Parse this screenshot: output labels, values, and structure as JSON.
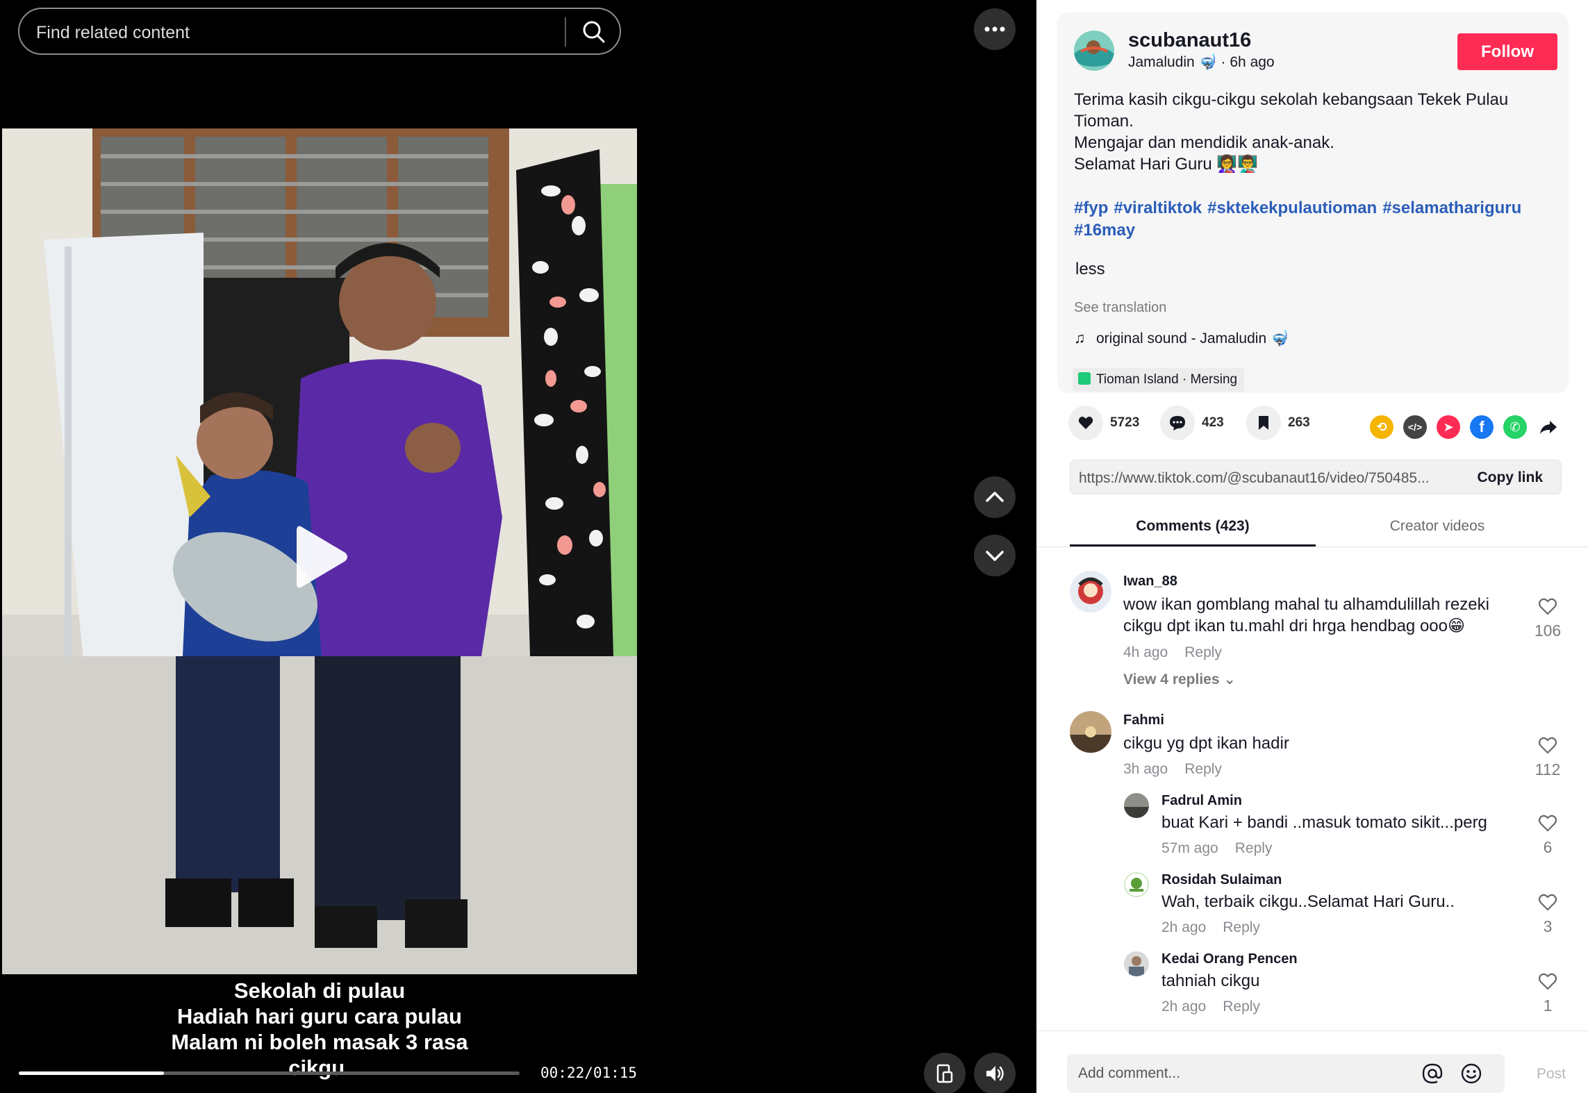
{
  "search": {
    "placeholder": "Find related content"
  },
  "video": {
    "caption_lines": [
      "Sekolah di pulau",
      "Hadiah hari guru cara pulau",
      "Malam ni boleh masak 3 rasa",
      "cikgu."
    ],
    "progress": 0.29,
    "time": "00:22/01:15"
  },
  "post": {
    "author": "scubanaut16",
    "author_name": "Jamaludin 🤿",
    "age": "6h ago",
    "follow_label": "Follow",
    "desc_lines": [
      "Terima kasih cikgu-cikgu sekolah kebangsaan Tekek Pulau",
      "Tioman.",
      "Mengajar dan mendidik anak-anak.",
      "Selamat Hari Guru 👩‍🏫👨‍🏫"
    ],
    "hashtags": [
      "#fyp",
      "#viraltiktok",
      "#sktekekpulautioman",
      "#selamathariguru",
      "#16may"
    ],
    "less_label": "less",
    "see_translation": "See translation",
    "sound": "original sound - Jamaludin 🤿",
    "location": "Tioman Island · Mersing"
  },
  "stats": {
    "likes": "5723",
    "comments": "423",
    "saves": "263"
  },
  "share_icons": [
    {
      "name": "repost-icon",
      "color": "#f5b400"
    },
    {
      "name": "embed-icon",
      "color": "#444444"
    },
    {
      "name": "send-icon",
      "color": "#fe2c55"
    },
    {
      "name": "facebook-icon",
      "color": "#1877f2"
    },
    {
      "name": "whatsapp-icon",
      "color": "#25d366"
    },
    {
      "name": "share-arrow-icon",
      "color": "#161823"
    }
  ],
  "link": {
    "url": "https://www.tiktok.com/@scubanaut16/video/750485...",
    "copy_label": "Copy link"
  },
  "tabs": {
    "comments": "Comments (423)",
    "videos": "Creator videos"
  },
  "comments": [
    {
      "user": "Iwan_88",
      "text": [
        "wow ikan gomblang mahal tu alhamdulillah rezeki",
        "cikgu dpt ikan tu.mahl dri hrga hendbag ooo😁"
      ],
      "age": "4h ago",
      "reply": "Reply",
      "likes": "106",
      "view_replies": "View 4 replies"
    },
    {
      "user": "Fahmi",
      "text": [
        "cikgu yg dpt ikan hadir"
      ],
      "age": "3h ago",
      "reply": "Reply",
      "likes": "112"
    },
    {
      "user": "Fadrul Amin",
      "text": [
        "buat Kari + bandi ..masuk tomato sikit...perg"
      ],
      "age": "57m ago",
      "reply": "Reply",
      "likes": "6"
    },
    {
      "user": "Rosidah Sulaiman",
      "text": [
        "Wah, terbaik cikgu..Selamat Hari Guru.."
      ],
      "age": "2h ago",
      "reply": "Reply",
      "likes": "3"
    },
    {
      "user": "Kedai Orang Pencen",
      "text": [
        "tahniah cikgu"
      ],
      "age": "2h ago",
      "reply": "Reply",
      "likes": "1"
    }
  ],
  "add_comment": {
    "placeholder": "Add comment...",
    "post_label": "Post"
  }
}
